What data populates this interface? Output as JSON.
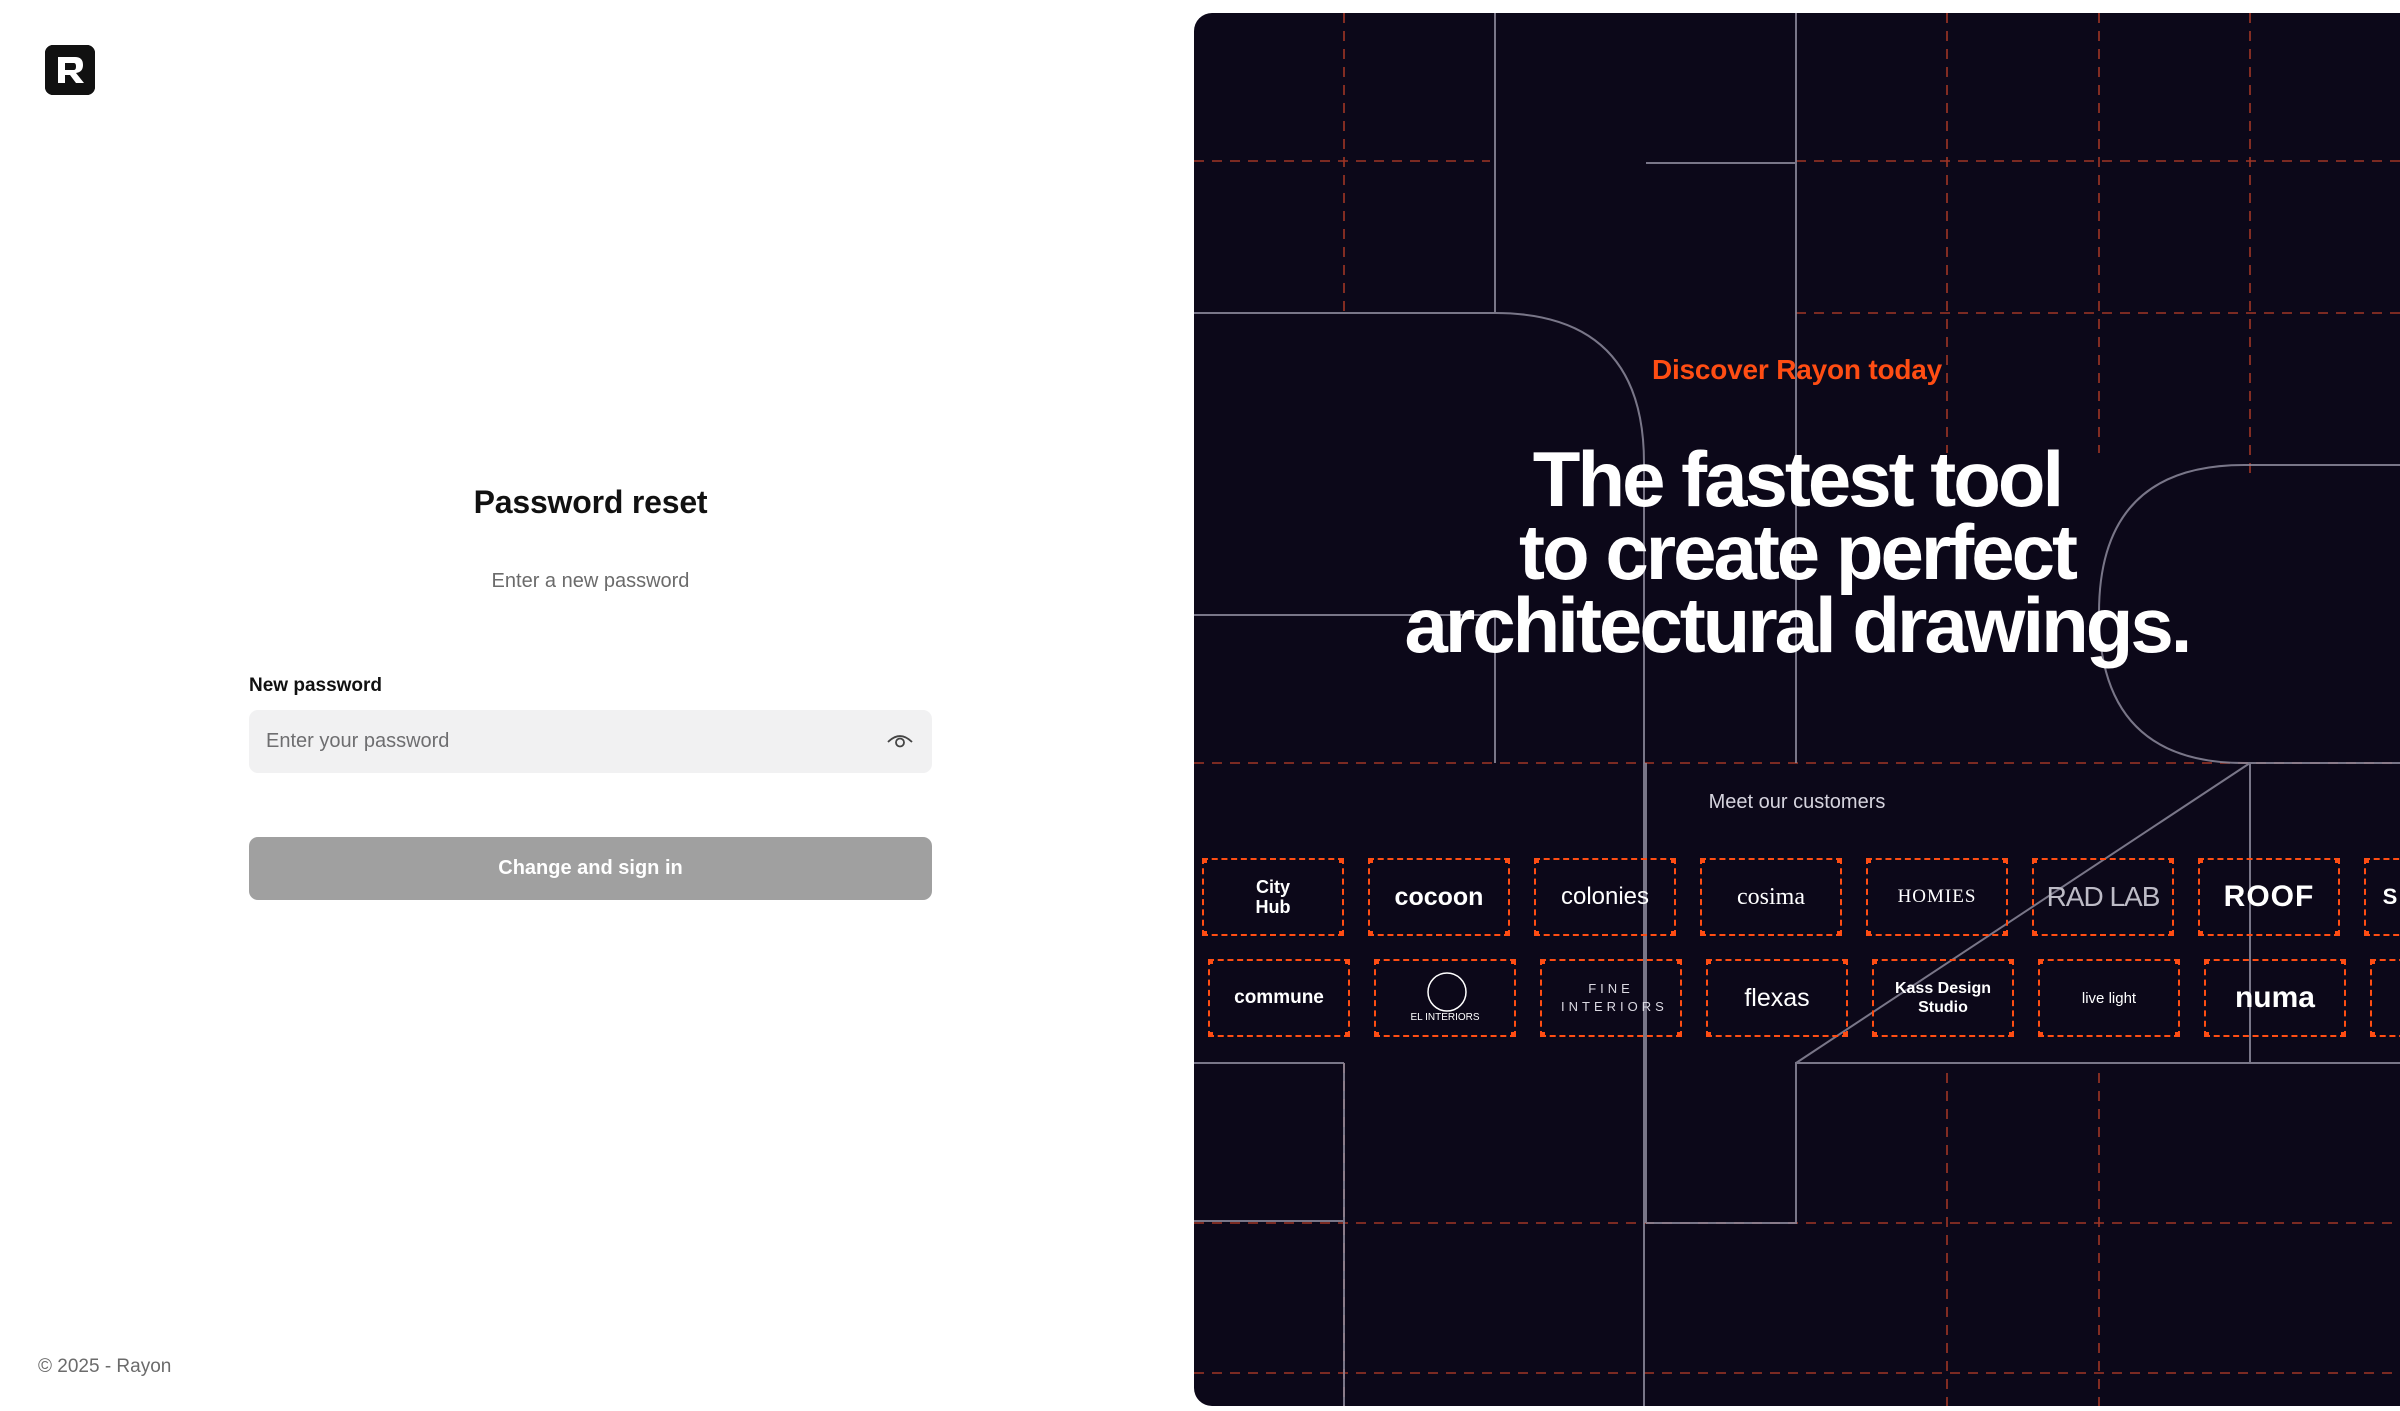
{
  "brand": {
    "logo_icon": "rayon-logo-icon"
  },
  "form": {
    "title": "Password reset",
    "subtitle": "Enter a new password",
    "field_label": "New password",
    "placeholder": "Enter your password",
    "value": "",
    "toggle_icon": "eye-icon",
    "submit_label": "Change and sign in"
  },
  "footer": {
    "copyright": "© 2025 - Rayon"
  },
  "promo": {
    "eyebrow": "Discover Rayon today",
    "headline": [
      "The fastest tool",
      "to create perfect",
      "architectural drawings."
    ],
    "customers_label": "Meet our customers",
    "row1": [
      "City Hub",
      "cocoon",
      "colonies",
      "cosima",
      "HOMIES",
      "RAD LAB",
      "ROOF",
      "S"
    ],
    "row2": [
      "commune",
      "EL INTERIORS",
      "FINE INTERIORS",
      "flexas",
      "Kass Design Studio",
      "live light",
      "numa",
      ""
    ]
  },
  "colors": {
    "accent": "#ff4d13",
    "promo_bg": "#0c0819",
    "button_disabled": "#a0a0a0",
    "input_bg": "#f1f1f2"
  }
}
